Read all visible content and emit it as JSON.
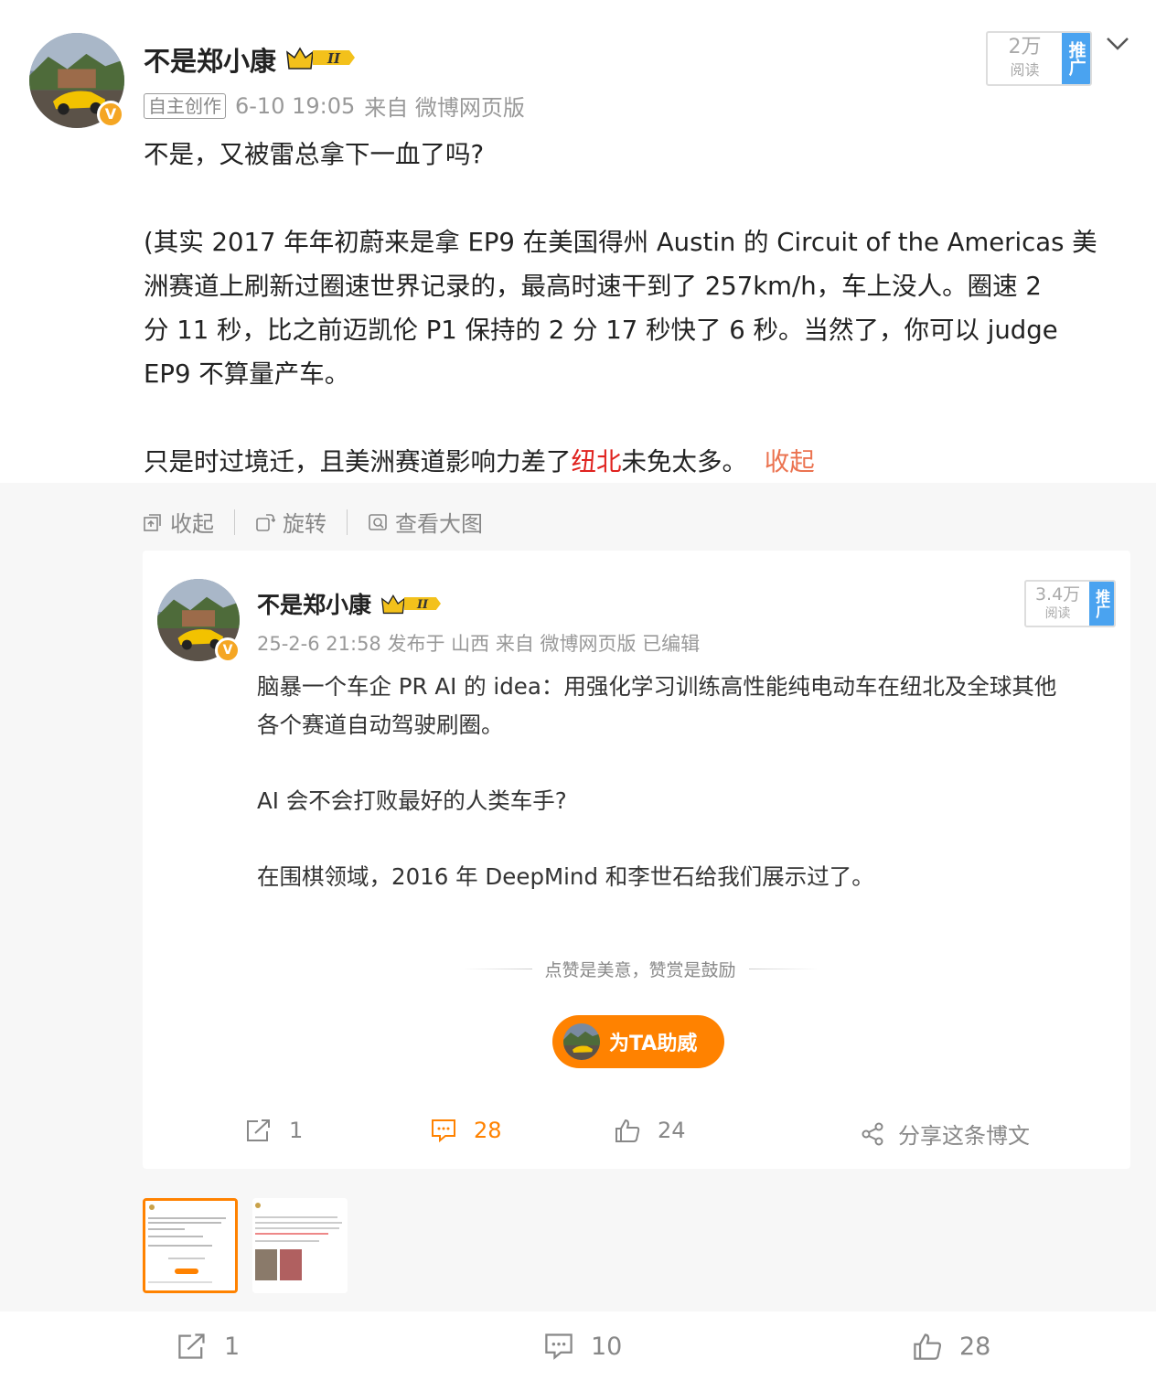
{
  "post": {
    "author": "不是郑小康",
    "level_badge": "II",
    "tag": "自主创作",
    "timestamp": "6-10 19:05",
    "source": "来自 微博网页版",
    "reads": {
      "count": "2万",
      "label": "阅读",
      "promo": "推广"
    },
    "paragraphs": {
      "p1": "不是，又被雷总拿下一血了吗?",
      "p2_l1": "(其实 2017 年年初蔚来是拿 EP9 在美国得州 Austin 的 Circuit of the Americas 美",
      "p2_l2": "洲赛道上刷新过圈速世界记录的，最高时速干到了 257km/h，车上没人。圈速 2",
      "p2_l3": "分 11 秒，比之前迈凯伦 P1 保持的 2 分 17 秒快了 6 秒。当然了，你可以 judge",
      "p2_l4": "EP9 不算量产车。",
      "p3_before": "只是时过境迁，且美洲赛道影响力差了",
      "p3_red": "纽北",
      "p3_after": "未免太多。",
      "collapse_link": "收起"
    }
  },
  "toolbar": {
    "collapse": "收起",
    "rotate": "旋转",
    "view_large": "查看大图"
  },
  "card": {
    "author": "不是郑小康",
    "level_badge": "II",
    "meta": "25-2-6 21:58 发布于 山西 来自 微博网页版 已编辑",
    "reads": {
      "count": "3.4万",
      "label": "阅读",
      "promo": "推广"
    },
    "l1": "脑暴一个车企 PR AI 的 idea：用强化学习训练高性能纯电动车在纽北及全球其他",
    "l2": "各个赛道自动驾驶刷圈。",
    "l3": "AI 会不会打败最好的人类车手?",
    "l4": "在围棋领域，2016 年 DeepMind 和李世石给我们展示过了。",
    "divider": "点赞是美意，赞赏是鼓励",
    "support_button": "为TA助威",
    "actions": {
      "repost": "1",
      "comment": "28",
      "like": "24",
      "share": "分享这条博文"
    }
  },
  "bottom": {
    "repost": "1",
    "comment": "10",
    "like": "28"
  },
  "colors": {
    "orange": "#ff8200",
    "red": "#e0231f",
    "link": "#eb7350",
    "blue": "#4aa3f0"
  }
}
